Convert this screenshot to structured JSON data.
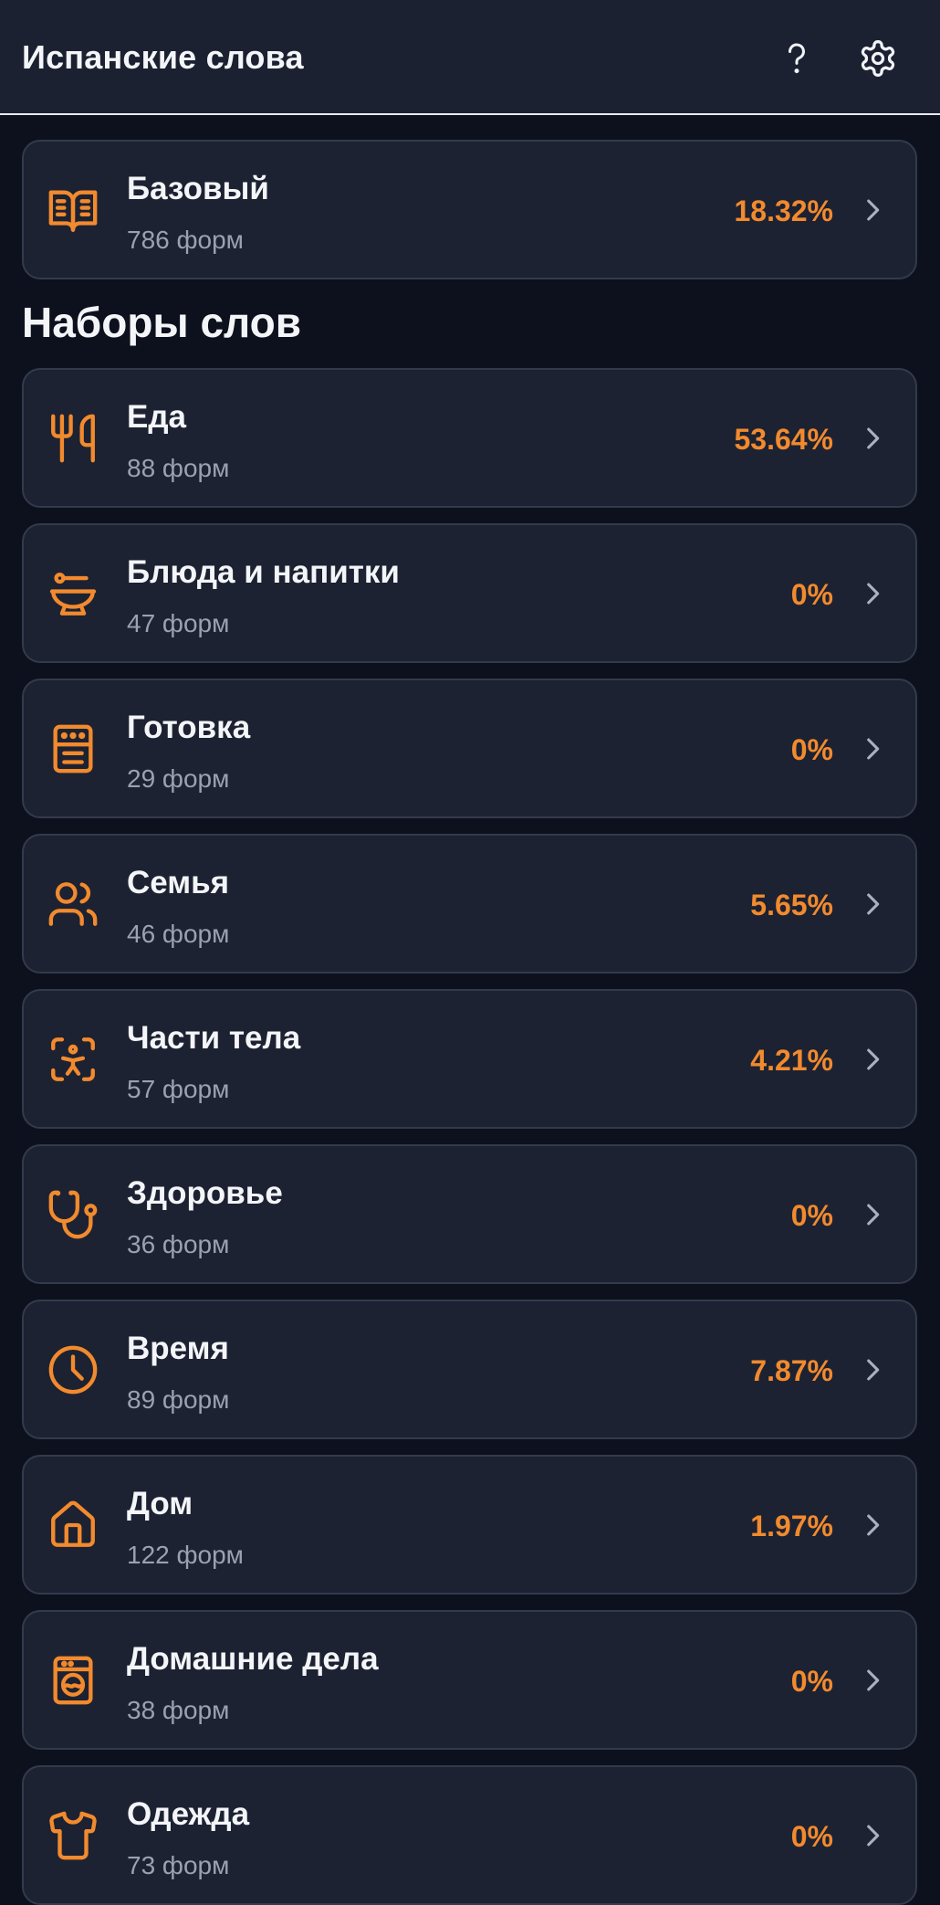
{
  "header": {
    "title": "Испанские слова",
    "help_icon": "question-mark-icon",
    "settings_icon": "gear-icon"
  },
  "colors": {
    "background": "#0c111d",
    "card": "#1c2232",
    "accent": "#f28a2e",
    "subtext": "#9aa1b1"
  },
  "base": {
    "title": "Базовый",
    "count": "786 форм",
    "percent": "18.32%",
    "icon": "book-open-icon"
  },
  "sets_heading": "Наборы слов",
  "sets": [
    {
      "title": "Еда",
      "count": "88 форм",
      "percent": "53.64%",
      "icon": "utensils-icon"
    },
    {
      "title": "Блюда и напитки",
      "count": "47 форм",
      "percent": "0%",
      "icon": "bowl-icon"
    },
    {
      "title": "Готовка",
      "count": "29 форм",
      "percent": "0%",
      "icon": "stove-icon"
    },
    {
      "title": "Семья",
      "count": "46 форм",
      "percent": "5.65%",
      "icon": "users-icon"
    },
    {
      "title": "Части тела",
      "count": "57 форм",
      "percent": "4.21%",
      "icon": "body-scan-icon"
    },
    {
      "title": "Здоровье",
      "count": "36 форм",
      "percent": "0%",
      "icon": "stethoscope-icon"
    },
    {
      "title": "Время",
      "count": "89 форм",
      "percent": "7.87%",
      "icon": "clock-icon"
    },
    {
      "title": "Дом",
      "count": "122 форм",
      "percent": "1.97%",
      "icon": "house-icon"
    },
    {
      "title": "Домашние дела",
      "count": "38 форм",
      "percent": "0%",
      "icon": "washing-machine-icon"
    },
    {
      "title": "Одежда",
      "count": "73 форм",
      "percent": "0%",
      "icon": "shirt-icon"
    }
  ]
}
